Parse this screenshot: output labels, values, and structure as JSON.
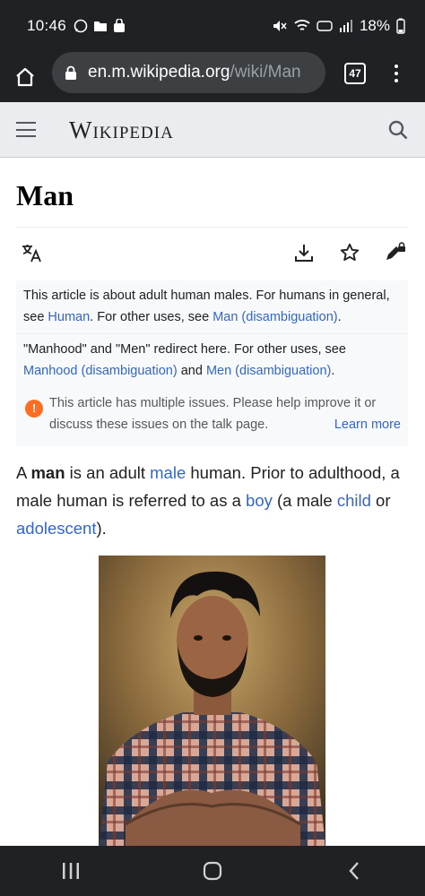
{
  "statusbar": {
    "time": "10:46",
    "battery": "18%",
    "left_icons": [
      "whatsapp-icon",
      "folder-icon",
      "shopping-bag-icon"
    ],
    "right_icons": [
      "mute-icon",
      "wifi-icon",
      "volte-icon",
      "signal-icon",
      "battery-icon"
    ]
  },
  "browser": {
    "url_main": "en.m.wikipedia.org",
    "url_path": "/wiki/Man",
    "tab_count": "47"
  },
  "wiki_header": {
    "logo": "Wikipedia"
  },
  "article": {
    "title": "Man",
    "actions": [
      "language-icon",
      "download-icon",
      "star-icon",
      "edit-locked-icon"
    ],
    "hatnote1": {
      "text1": "This article is about adult human males. For humans in general, see ",
      "link1": "Human",
      "text2": ". For other uses, see ",
      "link2": "Man (disambiguation)",
      "text3": "."
    },
    "hatnote2": {
      "text1": "\"Manhood\" and \"Men\" redirect here. For other uses, see ",
      "link1": "Manhood (disambiguation)",
      "text2": " and ",
      "link2": "Men (disambiguation)",
      "text3": "."
    },
    "issues": {
      "icon": "!",
      "text": "This article has multiple issues. Please help improve it or discuss these issues on the talk page.",
      "learn_more": "Learn more"
    },
    "lead": {
      "t1": "A ",
      "bold": "man",
      "t2": " is an adult ",
      "l1": "male",
      "t3": " human. Prior to adulthood, a male human is referred to as a ",
      "l2": "boy",
      "t4": " (a male ",
      "l3": "child",
      "t5": " or ",
      "l4": "adolescent",
      "t6": ")."
    }
  },
  "colors": {
    "link": "#3366cc",
    "issue_orange": "#ff6d22",
    "chrome_dark": "#202124"
  }
}
